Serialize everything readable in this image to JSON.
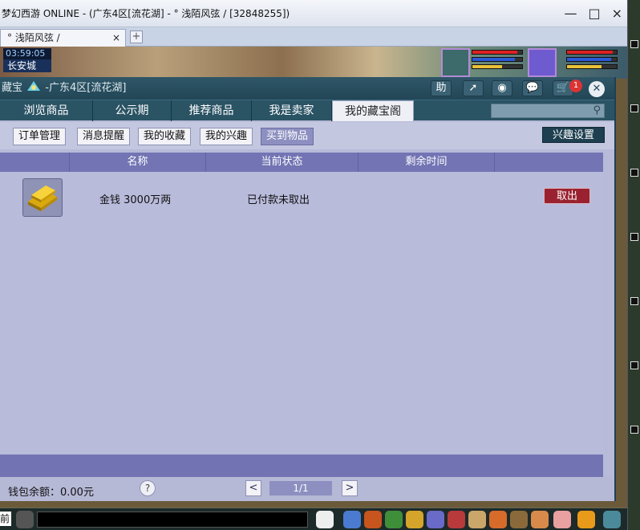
{
  "window": {
    "title": "梦幻西游 ONLINE - (广东4区[流花湖] - ° 浅陌风弦 / [32848255])",
    "controls": [
      "—",
      "□",
      "×"
    ]
  },
  "browser_tabs": [
    {
      "label": "° 浅陌风弦 /",
      "close": "×"
    }
  ],
  "new_tab": "+",
  "game": {
    "time": "03:59:05",
    "city": "长安城"
  },
  "dialog": {
    "title_prefix": "藏宝",
    "title_server": "-广东4区[流花湖]",
    "header_buttons": [
      "助",
      "➚",
      "◉",
      "💬",
      "🛒"
    ],
    "cart_count": "1",
    "close": "✕",
    "nav": [
      "浏览商品",
      "公示期",
      "推荐商品",
      "我是卖家",
      "我的藏宝阁"
    ],
    "nav_active": "我的藏宝阁",
    "search_icon": "search-icon",
    "sub_tabs": [
      "订单管理",
      "消息提醒",
      "我的收藏",
      "我的兴趣",
      "买到物品"
    ],
    "sub_active": "买到物品",
    "interest_settings": "兴趣设置",
    "columns": [
      "名称",
      "当前状态",
      "剩余时间"
    ],
    "rows": [
      {
        "icon": "gold-ingot-icon",
        "name": "金钱 3000万两",
        "status": "已付款未取出",
        "remaining": "",
        "action": "取出"
      }
    ],
    "footer": {
      "balance_label": "钱包余额：0.00元",
      "help": "?",
      "prev": "<",
      "page": "1/1",
      "next": ">"
    }
  },
  "colors": {
    "dialog_bg": "#b7bad8",
    "header_bg": "#224656",
    "table_header": "#7274b3",
    "takeout_button": "#9a2230"
  }
}
